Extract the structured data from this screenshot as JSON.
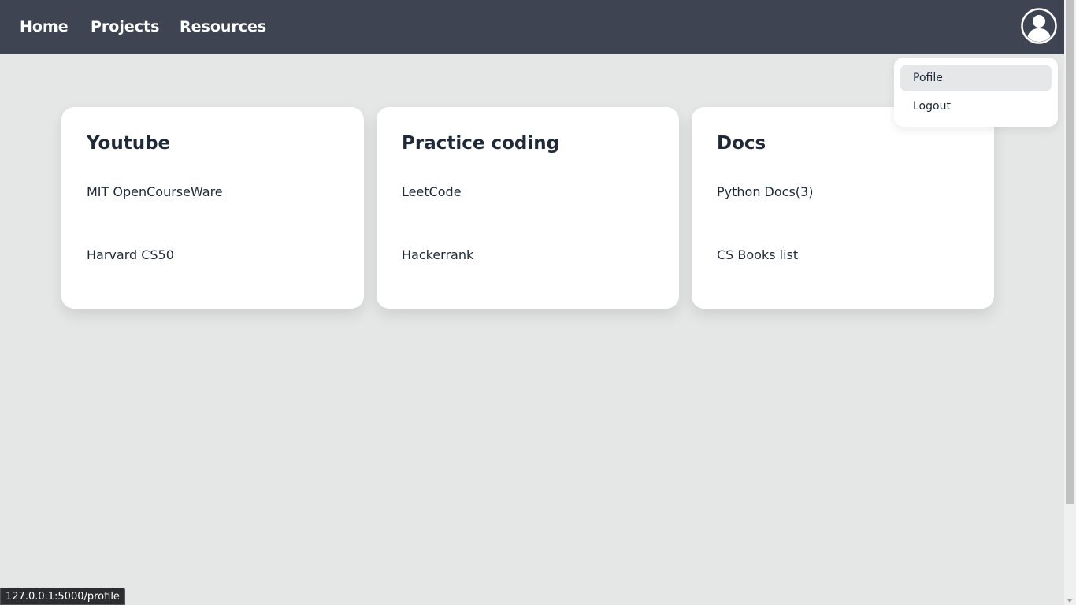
{
  "nav": {
    "links": [
      "Home",
      "Projects",
      "Resources"
    ]
  },
  "user_menu": {
    "icon": "user-circle-icon",
    "items": [
      "Pofile",
      "Logout"
    ]
  },
  "cards": [
    {
      "title": "Youtube",
      "links": [
        "MIT OpenCourseWare",
        "Harvard CS50"
      ]
    },
    {
      "title": "Practice coding",
      "links": [
        "LeetCode",
        "Hackerrank"
      ]
    },
    {
      "title": "Docs",
      "links": [
        "Python Docs(3)",
        "CS Books list"
      ]
    }
  ],
  "status_bar": {
    "url": "127.0.0.1:5000/profile"
  },
  "colors": {
    "navbar": "#3e4451",
    "background": "#e5e7e6",
    "card": "#ffffff",
    "text": "#1f2937"
  }
}
